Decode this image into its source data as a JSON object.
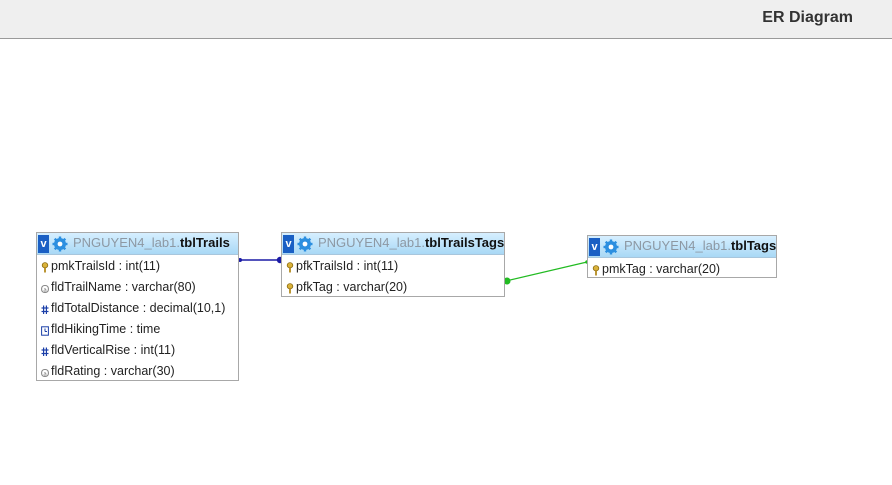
{
  "header": {
    "title": "ER Diagram"
  },
  "icons": {
    "toggle": "chevron-down-icon",
    "table": "gear-icon",
    "primary_key": "key-icon",
    "text": "text-field-icon",
    "numeric": "numeric-field-icon",
    "time": "time-field-icon"
  },
  "colors": {
    "relation_trails": "#1b1ba6",
    "relation_tags": "#22bb22",
    "header_top": "#d6efff",
    "header_bottom": "#a9d8f5",
    "toggle": "#1a5fc4"
  },
  "tables": [
    {
      "toggle": "v",
      "db": "PNGUYEN4_lab1.",
      "name": "tblTrails",
      "columns": [
        {
          "label": "pmkTrailsId : int(11)",
          "icon": "key-icon"
        },
        {
          "label": "fldTrailName : varchar(80)",
          "icon": "text-field-icon"
        },
        {
          "label": "fldTotalDistance : decimal(10,1)",
          "icon": "numeric-field-icon"
        },
        {
          "label": "fldHikingTime : time",
          "icon": "time-field-icon"
        },
        {
          "label": "fldVerticalRise : int(11)",
          "icon": "numeric-field-icon"
        },
        {
          "label": "fldRating : varchar(30)",
          "icon": "text-field-icon"
        }
      ]
    },
    {
      "toggle": "v",
      "db": "PNGUYEN4_lab1.",
      "name": "tblTrailsTags",
      "columns": [
        {
          "label": "pfkTrailsId : int(11)",
          "icon": "key-icon"
        },
        {
          "label": "pfkTag : varchar(20)",
          "icon": "key-icon"
        }
      ]
    },
    {
      "toggle": "v",
      "db": "PNGUYEN4_lab1.",
      "name": "tblTags",
      "columns": [
        {
          "label": "pmkTag : varchar(20)",
          "icon": "key-icon"
        }
      ]
    }
  ]
}
